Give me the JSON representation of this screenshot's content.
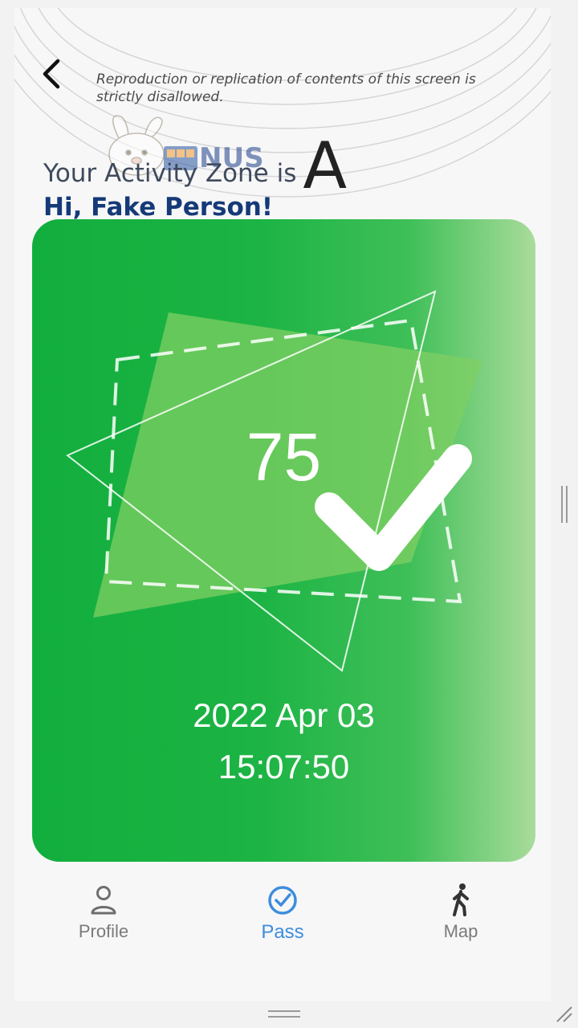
{
  "header": {
    "back_icon": "chevron-left-icon",
    "disclaimer": "Reproduction or replication of contents of this screen is strictly disallowed.",
    "zone_prefix": "Your Activity Zone is",
    "zone_letter": "A",
    "greeting": "Hi, Fake Person!",
    "logo_text": "NUS"
  },
  "pass_card": {
    "score": "75",
    "status_icon": "checkmark-icon",
    "date": "2022 Apr 03",
    "time": "15:07:50",
    "gradient_start": "#12ae3d",
    "gradient_end": "#a9dc9b"
  },
  "tabs": [
    {
      "label": "Profile",
      "icon": "person-icon",
      "active": false
    },
    {
      "label": "Pass",
      "icon": "check-circle-icon",
      "active": true
    },
    {
      "label": "Map",
      "icon": "walking-person-icon",
      "active": false
    }
  ],
  "colors": {
    "accent": "#3d8ddc",
    "greeting": "#153a78",
    "inactive_tab": "#7a7a7a"
  }
}
